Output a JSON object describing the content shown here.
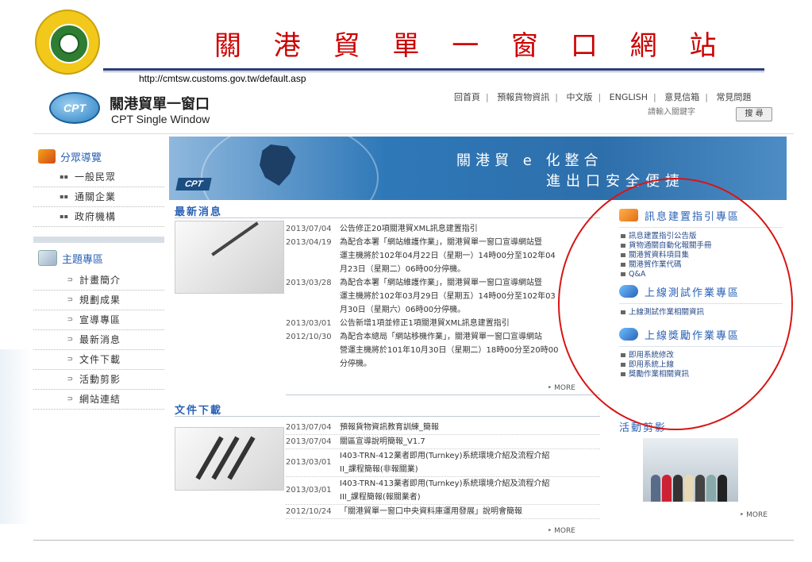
{
  "slide": {
    "title": "關 港 貿 單 一 窗 口 網 站",
    "url": "http://cmtsw.customs.gov.tw/default.asp"
  },
  "site": {
    "logo_text": "CPT",
    "title": "關港貿單一窗口",
    "subtitle": "CPT Single Window",
    "topnav": [
      "回首頁",
      "預報貨物資訊",
      "中文版",
      "ENGLISH",
      "意見信箱",
      "常見問題"
    ],
    "search": {
      "placeholder": "請輸入關鍵字",
      "button": "搜 尋"
    }
  },
  "leftnav": {
    "group1": {
      "title": "分眾導覽",
      "items": [
        "一般民眾",
        "通關企業",
        "政府機構"
      ]
    },
    "group2": {
      "title": "主題專區",
      "items": [
        "計畫簡介",
        "規劃成果",
        "宣導專區",
        "最新消息",
        "文件下載",
        "活動剪影",
        "網站連結"
      ]
    },
    "bullet1": "▪▪",
    "bullet2": "⊃"
  },
  "banner": {
    "tag": "CPT",
    "line1": "關港貿 e 化整合",
    "line2": "進出口安全便捷"
  },
  "news": {
    "title": "最新消息",
    "more": "‣ MORE",
    "items": [
      {
        "date": "2013/07/04",
        "lines": [
          "公告修正20項關港貿XML訊息建置指引"
        ]
      },
      {
        "date": "2013/04/19",
        "lines": [
          "為配合本署「網站維護作業」，關港貿單一窗口宣導網站暨",
          "運主機將於102年04月22日（星期一）14時00分至102年04",
          "月23日（星期二）06時00分停機。"
        ]
      },
      {
        "date": "2013/03/28",
        "lines": [
          "為配合本署「網站維護作業」，關港貿單一窗口宣導網站暨",
          "運主機將於102年03月29日（星期五）14時00分至102年03",
          "月30日（星期六）06時00分停機。"
        ]
      },
      {
        "date": "2013/03/01",
        "lines": [
          "公告新增1項並修正1項關港貿XML訊息建置指引"
        ]
      },
      {
        "date": "2012/10/30",
        "lines": [
          "為配合本總局「網站移機作業」，關港貿單一窗口宣導網站",
          "營運主機將於101年10月30日（星期二）18時00分至20時00",
          "分停機。"
        ]
      }
    ]
  },
  "downloads": {
    "title": "文件下載",
    "more": "‣ MORE",
    "items": [
      {
        "date": "2013/07/04",
        "lines": [
          "預報貨物資訊教育訓練_簡報"
        ]
      },
      {
        "date": "2013/07/04",
        "lines": [
          "關區宣導說明簡報_V1.7"
        ]
      },
      {
        "date": "2013/03/01",
        "lines": [
          "I403-TRN-412業者即用(Turnkey)系統環境介紹及流程介紹",
          "II_課程簡報(非報關業)"
        ]
      },
      {
        "date": "2013/03/01",
        "lines": [
          "I403-TRN-413業者即用(Turnkey)系統環境介紹及流程介紹",
          "III_課程簡報(報關業者)"
        ]
      },
      {
        "date": "2012/10/24",
        "lines": [
          "「關港貿單一窗口中央資料庫運用發展」說明會簡報"
        ]
      }
    ]
  },
  "right": {
    "sec1": {
      "title": "訊息建置指引專區",
      "items": [
        "訊息建置指引公告版",
        "貨物通關自動化報關手冊",
        "關港貿資料項目集",
        "關港貿作業代碼",
        "Q&A"
      ]
    },
    "sec2": {
      "title": "上線測試作業專區",
      "items": [
        "上線測試作業相關資訊"
      ]
    },
    "sec3": {
      "title": "上線獎勵作業專區",
      "items": [
        "即用系統修改",
        "即用系統上線",
        "獎勵作業相關資訊"
      ]
    },
    "activity": {
      "title": "活動剪影",
      "more": "‣ MORE"
    }
  }
}
